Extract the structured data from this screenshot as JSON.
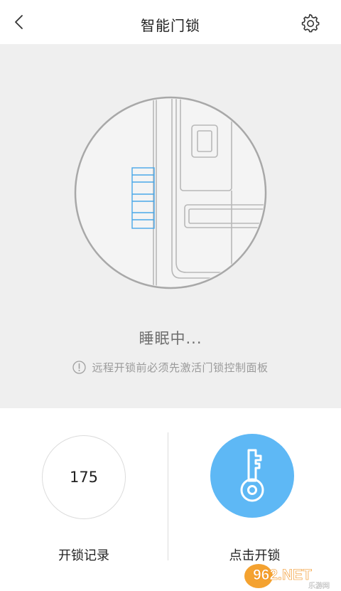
{
  "header": {
    "title": "智能门锁"
  },
  "hero": {
    "status": "睡眠中...",
    "notice": "远程开锁前必须先激活门锁控制面板"
  },
  "records": {
    "count": "175",
    "label": "开锁记录"
  },
  "unlock": {
    "label": "点击开锁"
  },
  "watermark": {
    "brand": "962.NET",
    "sub": "乐游网"
  },
  "colors": {
    "accent": "#5eb8f5",
    "hero_bg": "#efefef",
    "text_primary": "#222222",
    "text_muted": "#9a9a9a"
  },
  "icons": {
    "back": "chevron-left-icon",
    "settings": "gear-icon",
    "notice": "info-icon",
    "unlock": "key-icon"
  }
}
